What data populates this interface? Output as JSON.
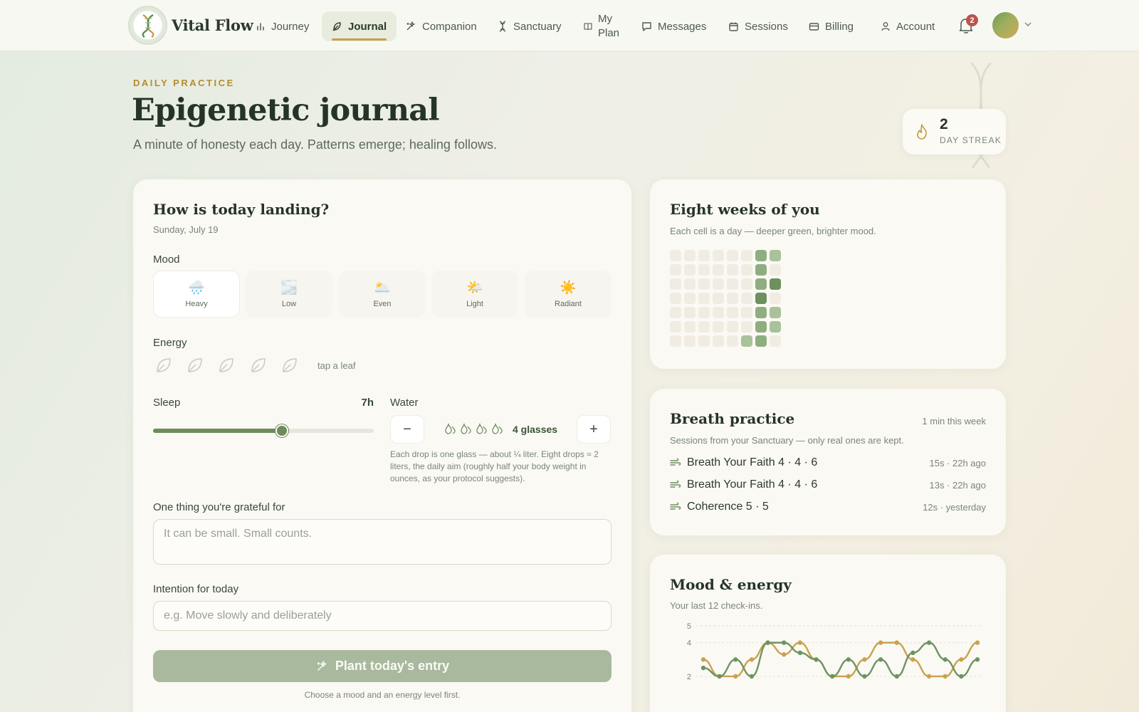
{
  "brand": {
    "name": "Vital Flow"
  },
  "nav": {
    "items": [
      {
        "id": "journey",
        "label": "Journey",
        "icon": "bar-chart-icon"
      },
      {
        "id": "journal",
        "label": "Journal",
        "icon": "feather-icon",
        "active": true
      },
      {
        "id": "companion",
        "label": "Companion",
        "icon": "sparkles-icon"
      },
      {
        "id": "sanctuary",
        "label": "Sanctuary",
        "icon": "dna-icon"
      },
      {
        "id": "my-plan",
        "label_line1": "My",
        "label_line2": "Plan",
        "icon": "book-icon"
      },
      {
        "id": "messages",
        "label": "Messages",
        "icon": "chat-icon"
      },
      {
        "id": "sessions",
        "label": "Sessions",
        "icon": "calendar-icon"
      },
      {
        "id": "billing",
        "label": "Billing",
        "icon": "card-icon"
      },
      {
        "id": "account",
        "label": "Account",
        "icon": "user-icon"
      }
    ],
    "notification_count": "2"
  },
  "header": {
    "eyebrow": "DAILY PRACTICE",
    "title": "Epigenetic journal",
    "subtitle": "A minute of honesty each day. Patterns emerge; healing follows.",
    "streak_count": "2",
    "streak_label": "DAY STREAK"
  },
  "journal": {
    "title": "How is today landing?",
    "date": "Sunday, July 19",
    "mood_label": "Mood",
    "moods": [
      {
        "label": "Heavy",
        "emoji": "🌧️"
      },
      {
        "label": "Low",
        "emoji": "🌫️"
      },
      {
        "label": "Even",
        "emoji": "🌥️"
      },
      {
        "label": "Light",
        "emoji": "🌤️"
      },
      {
        "label": "Radiant",
        "emoji": "☀️"
      }
    ],
    "energy_label": "Energy",
    "energy_hint": "tap a leaf",
    "sleep_label": "Sleep",
    "sleep_value": "7h",
    "sleep_hours": 7,
    "sleep_max": 12,
    "water_label": "Water",
    "water_glasses": 4,
    "water_text": "4 glasses",
    "water_minus": "−",
    "water_plus": "+",
    "water_note": "Each drop is one glass — about ¼ liter. Eight drops ≈ 2 liters, the daily aim (roughly half your body weight in ounces, as your protocol suggests).",
    "grateful_label": "One thing you're grateful for",
    "grateful_placeholder": "It can be small. Small counts.",
    "intention_label": "Intention for today",
    "intention_placeholder": "e.g. Move slowly and deliberately",
    "submit_label": "Plant today's entry",
    "submit_note": "Choose a mood and an energy level first."
  },
  "weeks": {
    "title": "Eight weeks of you",
    "subtitle": "Each cell is a day — deeper green, brighter mood.",
    "grid": [
      [
        0,
        0,
        0,
        0,
        0,
        0,
        3,
        2
      ],
      [
        0,
        0,
        0,
        0,
        0,
        0,
        3,
        0
      ],
      [
        0,
        0,
        0,
        0,
        0,
        0,
        3,
        4
      ],
      [
        0,
        0,
        0,
        0,
        0,
        0,
        4,
        0
      ],
      [
        0,
        0,
        0,
        0,
        0,
        0,
        3,
        2
      ],
      [
        0,
        0,
        0,
        0,
        0,
        0,
        3,
        2
      ],
      [
        0,
        0,
        0,
        0,
        0,
        2,
        3,
        0
      ]
    ],
    "colors": [
      "#f1ece2",
      "#dfe6d4",
      "#a9c29a",
      "#8fae80",
      "#6e8f5e"
    ]
  },
  "breath": {
    "title": "Breath practice",
    "meta": "1 min this week",
    "subtitle": "Sessions from your Sanctuary — only real ones are kept.",
    "sessions": [
      {
        "name": "Breath Your Faith 4 · 4 · 6",
        "meta": "15s · 22h ago"
      },
      {
        "name": "Breath Your Faith 4 · 4 · 6",
        "meta": "13s · 22h ago"
      },
      {
        "name": "Coherence 5 · 5",
        "meta": "12s · yesterday"
      }
    ]
  },
  "chart_data": {
    "type": "line",
    "title": "Mood & energy",
    "subtitle": "Your last 12 check-ins.",
    "x": [
      1,
      2,
      3,
      4,
      5,
      6,
      7,
      8,
      9,
      10,
      11,
      12,
      13,
      14,
      15,
      16,
      17,
      18
    ],
    "ylim": [
      1.7,
      5
    ],
    "yticks": [
      5,
      4,
      2
    ],
    "grid": true,
    "series": [
      {
        "color": "#c9a24f",
        "values": [
          3,
          2,
          2,
          3,
          4,
          3.3,
          4,
          3,
          2,
          2,
          3,
          4,
          4,
          3,
          2,
          2,
          3,
          4
        ]
      },
      {
        "color": "#6e9363",
        "values": [
          2.5,
          2,
          3,
          2,
          4,
          4,
          3.4,
          3,
          2,
          3,
          2,
          3,
          2,
          3.4,
          4,
          3,
          2,
          3
        ]
      }
    ]
  }
}
